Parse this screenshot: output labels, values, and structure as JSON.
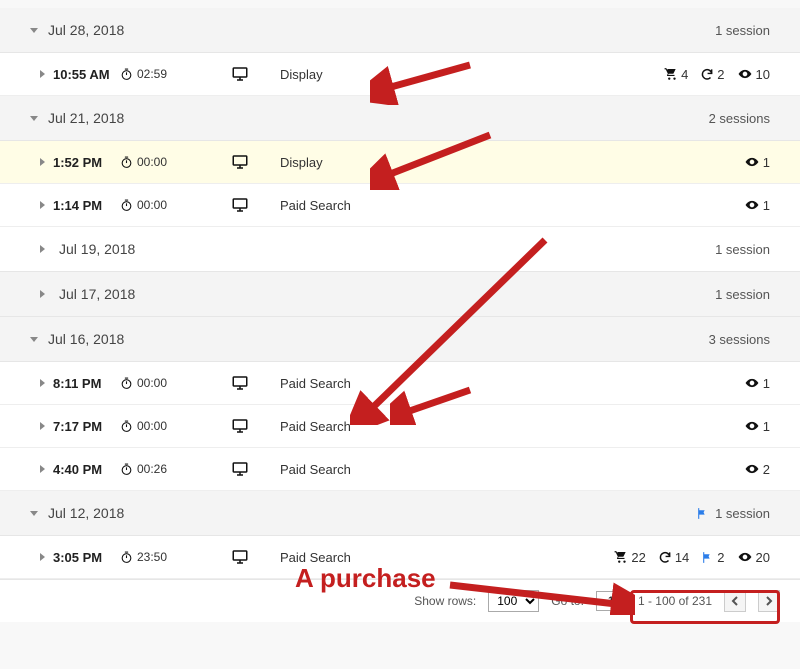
{
  "days": [
    {
      "date": "Jul 28, 2018",
      "expanded": true,
      "white": false,
      "summary": "1 session",
      "flag": false,
      "sessions": [
        {
          "time": "10:55 AM",
          "duration": "02:59",
          "source": "Display",
          "hl": false,
          "stats": [
            {
              "icon": "cart",
              "v": "4"
            },
            {
              "icon": "refresh",
              "v": "2"
            },
            {
              "icon": "eye",
              "v": "10"
            }
          ]
        }
      ]
    },
    {
      "date": "Jul 21, 2018",
      "expanded": true,
      "white": false,
      "summary": "2 sessions",
      "flag": false,
      "sessions": [
        {
          "time": "1:52 PM",
          "duration": "00:00",
          "source": "Display",
          "hl": true,
          "stats": [
            {
              "icon": "eye",
              "v": "1"
            }
          ]
        },
        {
          "time": "1:14 PM",
          "duration": "00:00",
          "source": "Paid Search",
          "hl": false,
          "stats": [
            {
              "icon": "eye",
              "v": "1"
            }
          ]
        }
      ]
    },
    {
      "date": "Jul 19, 2018",
      "expanded": false,
      "white": true,
      "summary": "1 session",
      "flag": false,
      "sessions": []
    },
    {
      "date": "Jul 17, 2018",
      "expanded": false,
      "white": false,
      "summary": "1 session",
      "flag": false,
      "sessions": []
    },
    {
      "date": "Jul 16, 2018",
      "expanded": true,
      "white": false,
      "summary": "3 sessions",
      "flag": false,
      "sessions": [
        {
          "time": "8:11 PM",
          "duration": "00:00",
          "source": "Paid Search",
          "hl": false,
          "stats": [
            {
              "icon": "eye",
              "v": "1"
            }
          ]
        },
        {
          "time": "7:17 PM",
          "duration": "00:00",
          "source": "Paid Search",
          "hl": false,
          "stats": [
            {
              "icon": "eye",
              "v": "1"
            }
          ]
        },
        {
          "time": "4:40 PM",
          "duration": "00:26",
          "source": "Paid Search",
          "hl": false,
          "stats": [
            {
              "icon": "eye",
              "v": "2"
            }
          ]
        }
      ]
    },
    {
      "date": "Jul 12, 2018",
      "expanded": true,
      "white": false,
      "summary": "1 session",
      "flag": true,
      "sessions": [
        {
          "time": "3:05 PM",
          "duration": "23:50",
          "source": "Paid Search",
          "hl": false,
          "stats": [
            {
              "icon": "cart",
              "v": "22"
            },
            {
              "icon": "refresh",
              "v": "14"
            },
            {
              "icon": "flag",
              "v": "2"
            },
            {
              "icon": "eye",
              "v": "20"
            }
          ]
        }
      ]
    }
  ],
  "pagination": {
    "show_rows_label": "Show rows:",
    "show_rows_value": "100",
    "goto_label": "Go to:",
    "goto_value": "1",
    "range": "1 - 100 of 231"
  },
  "annotation_label": "A purchase"
}
